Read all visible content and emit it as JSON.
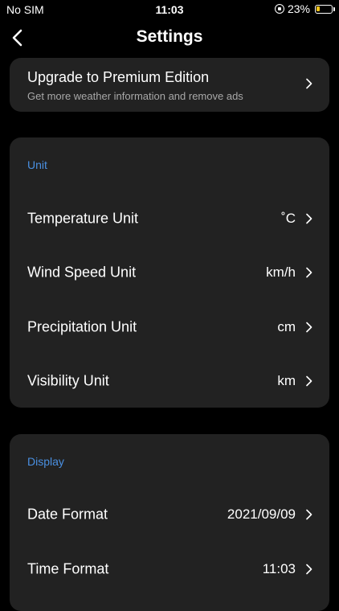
{
  "status_bar": {
    "carrier": "No SIM",
    "time": "11:03",
    "battery": "23%",
    "battery_level": 0.23
  },
  "nav": {
    "title": "Settings",
    "back_icon": "chevron-left-icon"
  },
  "premium": {
    "title": "Upgrade to Premium Edition",
    "subtitle": "Get more weather information and remove ads"
  },
  "unit_section": {
    "header": "Unit",
    "rows": [
      {
        "label": "Temperature Unit",
        "value": "˚C"
      },
      {
        "label": "Wind Speed Unit",
        "value": "km/h"
      },
      {
        "label": "Precipitation Unit",
        "value": "cm"
      },
      {
        "label": "Visibility Unit",
        "value": "km"
      }
    ]
  },
  "display_section": {
    "header": "Display",
    "rows": [
      {
        "label": "Date Format",
        "value": "2021/09/09"
      },
      {
        "label": "Time Format",
        "value": "11:03"
      }
    ]
  },
  "colors": {
    "background": "#000000",
    "card": "#222222",
    "accent": "#4a90e2",
    "secondary_text": "#a8a8a8",
    "battery": "#f5c518"
  }
}
